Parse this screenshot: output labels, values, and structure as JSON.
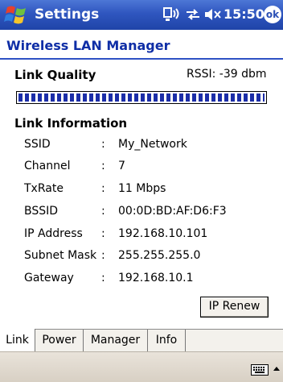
{
  "titlebar": {
    "title": "Settings",
    "clock": "15:50",
    "ok_label": "ok",
    "icons": [
      "start-flag-icon",
      "connectivity-icon",
      "data-sync-icon",
      "speaker-muted-icon"
    ]
  },
  "app": {
    "heading": "Wireless LAN Manager"
  },
  "link_quality": {
    "title": "Link Quality",
    "rssi": "RSSI: -39 dbm",
    "signal_fraction": 1.0
  },
  "link_information": {
    "title": "Link Information",
    "rows": [
      {
        "label": "SSID",
        "value": "My_Network"
      },
      {
        "label": "Channel",
        "value": "7"
      },
      {
        "label": "TxRate",
        "value": "11 Mbps"
      },
      {
        "label": "BSSID",
        "value": "00:0D:BD:AF:D6:F3"
      },
      {
        "label": "IP Address",
        "value": "192.168.10.101"
      },
      {
        "label": "Subnet Mask",
        "value": "255.255.255.0"
      },
      {
        "label": "Gateway",
        "value": "192.168.10.1"
      }
    ],
    "separator": ":"
  },
  "buttons": {
    "ip_renew": "IP Renew"
  },
  "tabs": [
    {
      "label": "Link",
      "active": true
    },
    {
      "label": "Power",
      "active": false
    },
    {
      "label": "Manager",
      "active": false
    },
    {
      "label": "Info",
      "active": false
    }
  ],
  "colors": {
    "titlebar": "#2f56bf",
    "heading": "#0f2ea6",
    "signal_bar": "#1c2ea8"
  }
}
